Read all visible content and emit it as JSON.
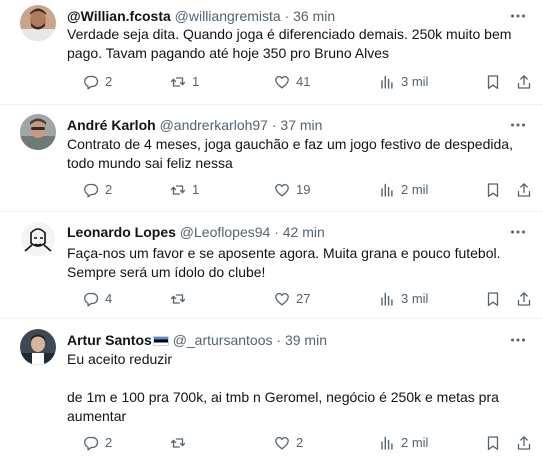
{
  "tweets": [
    {
      "name": "@Willian.fcosta",
      "handle": "@williangremista",
      "time": "· 36 min",
      "lines": [
        "Verdade seja dita. Quando joga é diferenciado demais. 250k muito bem",
        "pago. Tavam pagando até hoje 350 pro Bruno Alves"
      ],
      "replies": "2",
      "retweets": "1",
      "likes": "41",
      "views": "3 mil"
    },
    {
      "name": "André Karloh",
      "handle": "@andrerkarloh97",
      "time": "· 37 min",
      "lines": [
        "Contrato de 4 meses, joga gauchão e faz um jogo festivo de despedida,",
        "todo mundo sai feliz nessa"
      ],
      "replies": "2",
      "retweets": "1",
      "likes": "19",
      "views": "2 mil"
    },
    {
      "name": "Leonardo Lopes",
      "handle": "@Leoflopes94",
      "time": "· 42 min",
      "lines": [
        "Faça-nos um favor e se aposente agora. Muita grana e pouco futebol.",
        "Sempre será um ídolo do clube!"
      ],
      "replies": "4",
      "retweets": "",
      "likes": "27",
      "views": "3 mil"
    },
    {
      "name": "Artur Santos",
      "handle": "@_artursantoos",
      "time": "· 39 min",
      "lines": [
        "Eu aceito reduzir",
        "",
        "de 1m e 100 pra 700k, ai tmb n Geromel, negócio é 250k e metas pra",
        "aumentar"
      ],
      "replies": "2",
      "retweets": "",
      "likes": "2",
      "views": "2 mil"
    }
  ],
  "icons": {
    "reply": "reply-icon",
    "retweet": "retweet-icon",
    "like": "heart-icon",
    "views": "views-chart-icon",
    "bookmark": "bookmark-icon",
    "share": "share-icon",
    "more": "more-dots-icon"
  },
  "colors": {
    "text": "#0f1419",
    "secondary": "#536471",
    "divider": "#eff3f4"
  }
}
